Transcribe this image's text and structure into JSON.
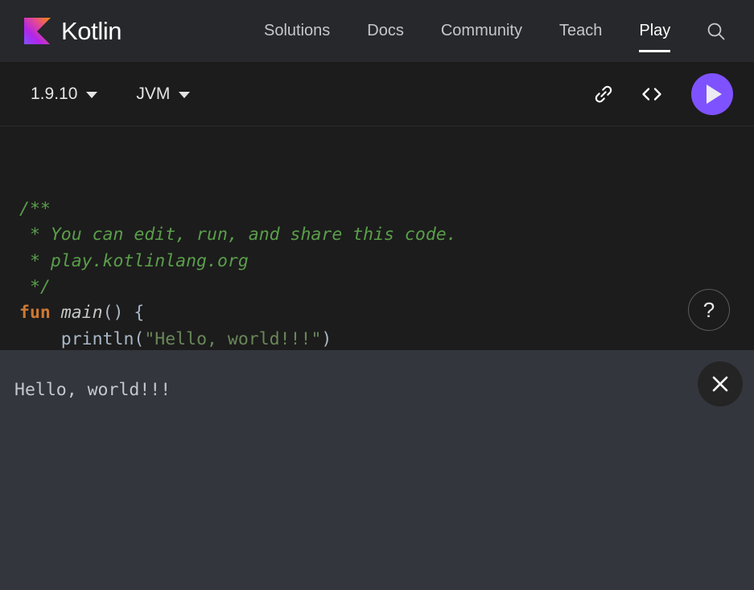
{
  "header": {
    "brand_name": "Kotlin",
    "logo_icon": "kotlin-logo",
    "nav_items": [
      {
        "label": "Solutions",
        "active": false
      },
      {
        "label": "Docs",
        "active": false
      },
      {
        "label": "Community",
        "active": false
      },
      {
        "label": "Teach",
        "active": false
      },
      {
        "label": "Play",
        "active": true
      }
    ],
    "search_icon": "search-icon",
    "background_color": "#27282C"
  },
  "toolbar": {
    "version": "1.9.10",
    "target": "JVM",
    "chevron_icon": "chevron-down-icon",
    "copy_link_icon": "link-icon",
    "embed_code_icon": "code-brackets-icon",
    "run_icon": "play-icon",
    "run_button_color": "#7F52FF"
  },
  "editor": {
    "help_label": "?",
    "help_icon": "question-mark-icon",
    "lines": [
      {
        "tokens": [
          {
            "t": "/**",
            "c": "cm"
          }
        ]
      },
      {
        "tokens": [
          {
            "t": " * You can edit, run, and share this code.",
            "c": "cm"
          }
        ]
      },
      {
        "tokens": [
          {
            "t": " * play.kotlinlang.org",
            "c": "cm"
          }
        ]
      },
      {
        "tokens": [
          {
            "t": " */",
            "c": "cm"
          }
        ]
      },
      {
        "tokens": [
          {
            "t": "fun",
            "c": "kw"
          },
          {
            "t": " ",
            "c": "plain"
          },
          {
            "t": "main",
            "c": "fnname"
          },
          {
            "t": "() {",
            "c": "punc"
          }
        ]
      },
      {
        "tokens": [
          {
            "t": "    println",
            "c": "plain"
          },
          {
            "t": "(",
            "c": "punc"
          },
          {
            "t": "\"Hello, world!!!\"",
            "c": "str"
          },
          {
            "t": ")",
            "c": "punc"
          }
        ]
      },
      {
        "tokens": [
          {
            "t": "}",
            "c": "punc"
          }
        ]
      }
    ]
  },
  "output": {
    "text": "Hello, world!!!",
    "close_icon": "close-icon",
    "background_color": "#33363D"
  }
}
